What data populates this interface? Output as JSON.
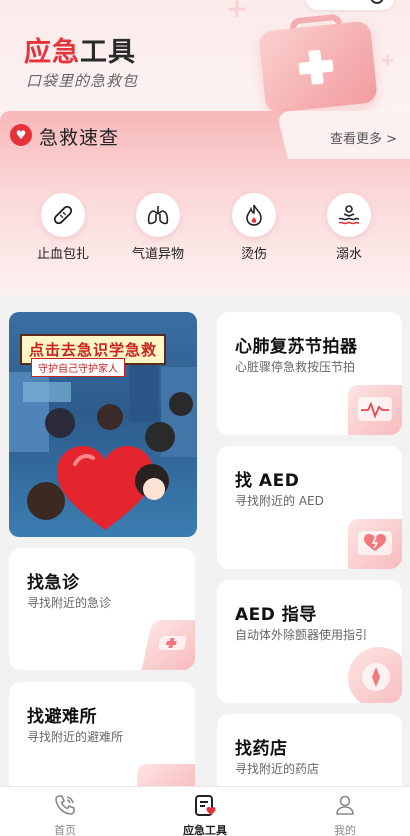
{
  "hero": {
    "title_red": "应急",
    "title_dark": "工具",
    "subtitle": "口袋里的急救包"
  },
  "quick_check": {
    "title": "急救速查",
    "more": "查看更多 >",
    "items": [
      {
        "label": "止血包扎",
        "icon": "bandage-icon"
      },
      {
        "label": "气道异物",
        "icon": "lungs-icon"
      },
      {
        "label": "烫伤",
        "icon": "flame-icon"
      },
      {
        "label": "溺水",
        "icon": "drowning-icon"
      }
    ]
  },
  "banner": {
    "title": "点击去急识学急救",
    "subtitle": "守护自己守护家人"
  },
  "cards": {
    "cpr": {
      "title": "心肺复苏节拍器",
      "sub": "心脏骤停急救按压节拍"
    },
    "find_aed": {
      "title": "找 AED",
      "sub": "寻找附近的 AED"
    },
    "emergency": {
      "title": "找急诊",
      "sub": "寻找附近的急诊"
    },
    "aed_guide": {
      "title": "AED 指导",
      "sub": "自动体外除颤器使用指引"
    },
    "shelter": {
      "title": "找避难所",
      "sub": "寻找附近的避难所"
    },
    "pharmacy": {
      "title": "找药店",
      "sub": "寻找附近的药店"
    }
  },
  "nav": {
    "items": [
      {
        "label": "首页",
        "icon": "phone-icon",
        "active": false
      },
      {
        "label": "应急工具",
        "icon": "toolkit-icon",
        "active": true
      },
      {
        "label": "我的",
        "icon": "user-icon",
        "active": false
      }
    ]
  },
  "colors": {
    "accent": "#e8323a",
    "pink_bg": "#f8b8ba"
  }
}
